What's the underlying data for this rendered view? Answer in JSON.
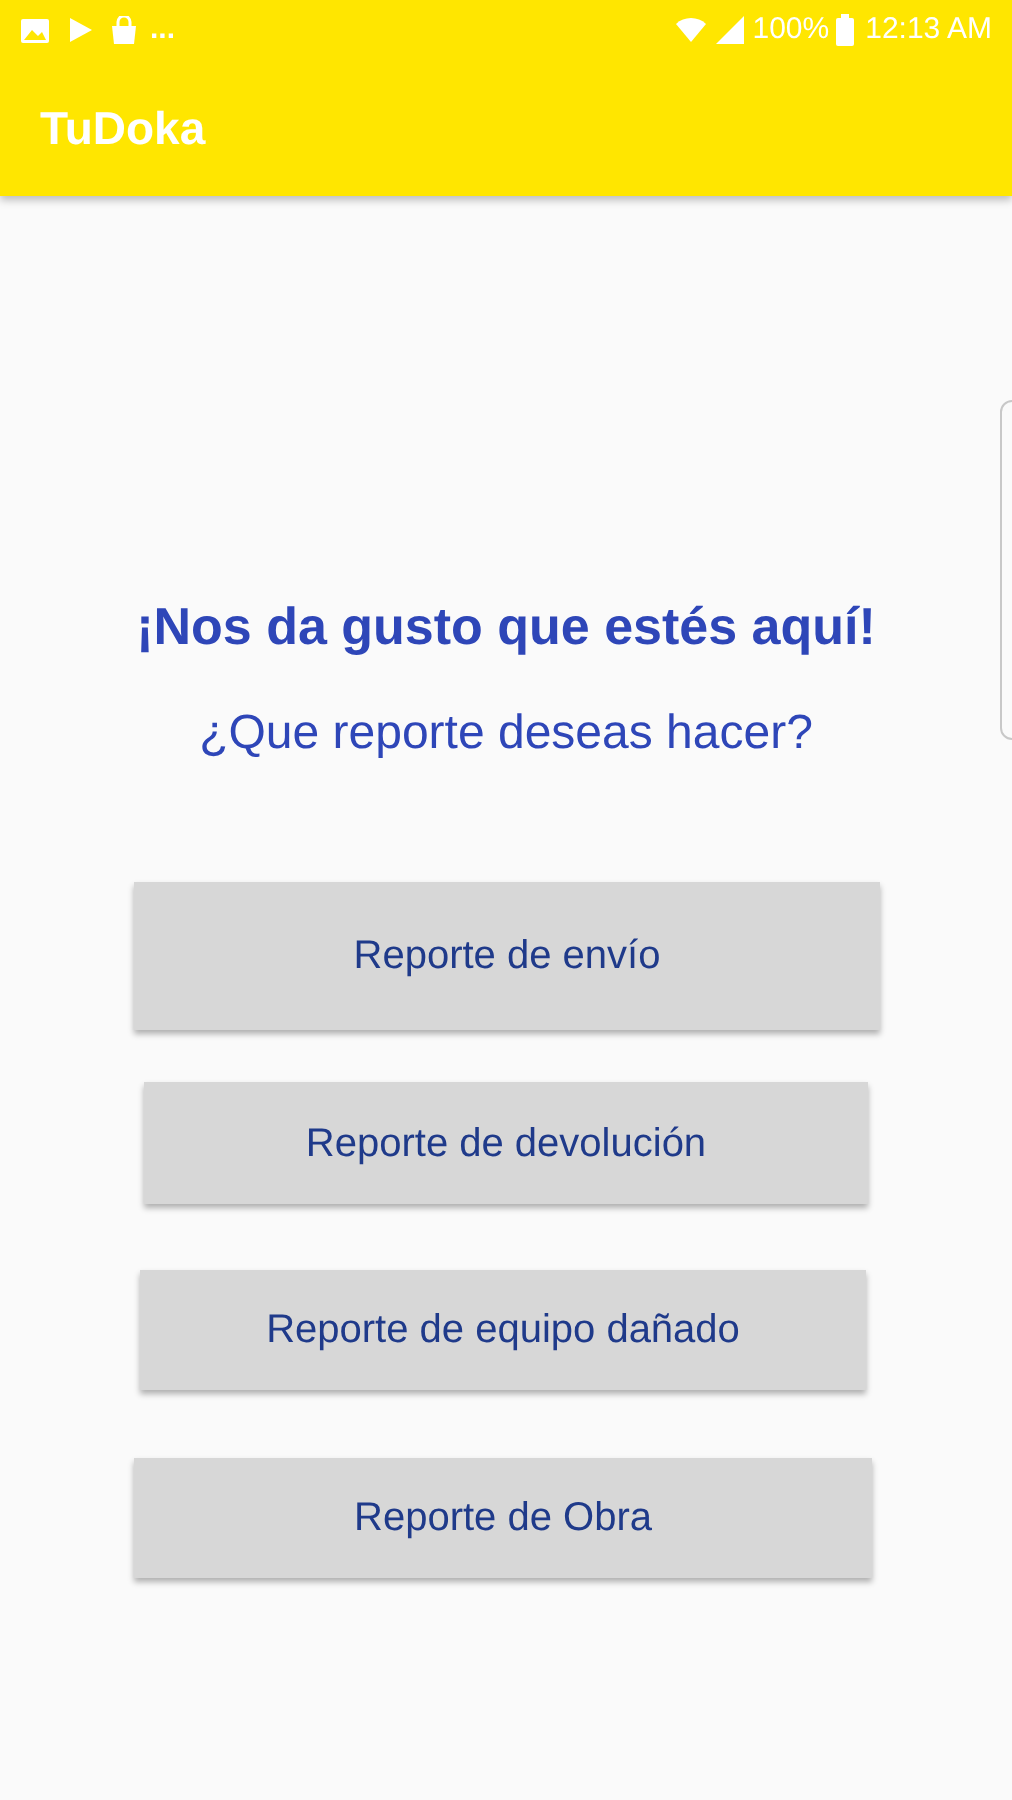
{
  "status_bar": {
    "more": "...",
    "battery_percent": "100%",
    "time": "12:13 AM"
  },
  "app_bar": {
    "title": "TuDoka"
  },
  "heading": "¡Nos da gusto que estés aquí!",
  "subheading": "¿Que reporte deseas hacer?",
  "buttons": [
    "Reporte de envío",
    "Reporte de devolución",
    "Reporte de equipo dañado",
    "Reporte de Obra"
  ]
}
